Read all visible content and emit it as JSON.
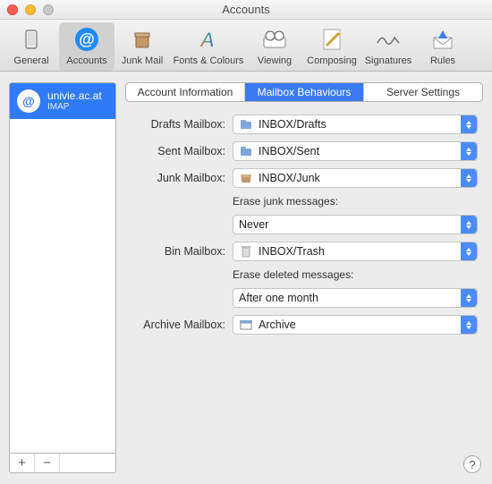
{
  "window": {
    "title": "Accounts"
  },
  "toolbar": {
    "items": [
      {
        "label": "General"
      },
      {
        "label": "Accounts"
      },
      {
        "label": "Junk Mail"
      },
      {
        "label": "Fonts & Colours"
      },
      {
        "label": "Viewing"
      },
      {
        "label": "Composing"
      },
      {
        "label": "Signatures"
      },
      {
        "label": "Rules"
      }
    ]
  },
  "sidebar": {
    "account": {
      "name": "univie.ac.at",
      "type": "IMAP"
    },
    "add": "+",
    "remove": "−"
  },
  "tabs": {
    "info": "Account Information",
    "mailbox": "Mailbox Behaviours",
    "server": "Server Settings"
  },
  "form": {
    "drafts_label": "Drafts Mailbox:",
    "drafts_value": "INBOX/Drafts",
    "sent_label": "Sent Mailbox:",
    "sent_value": "INBOX/Sent",
    "junk_label": "Junk Mailbox:",
    "junk_value": "INBOX/Junk",
    "erase_junk_label": "Erase junk messages:",
    "erase_junk_value": "Never",
    "bin_label": "Bin Mailbox:",
    "bin_value": "INBOX/Trash",
    "erase_del_label": "Erase deleted messages:",
    "erase_del_value": "After one month",
    "archive_label": "Archive Mailbox:",
    "archive_value": "Archive"
  },
  "help": "?"
}
